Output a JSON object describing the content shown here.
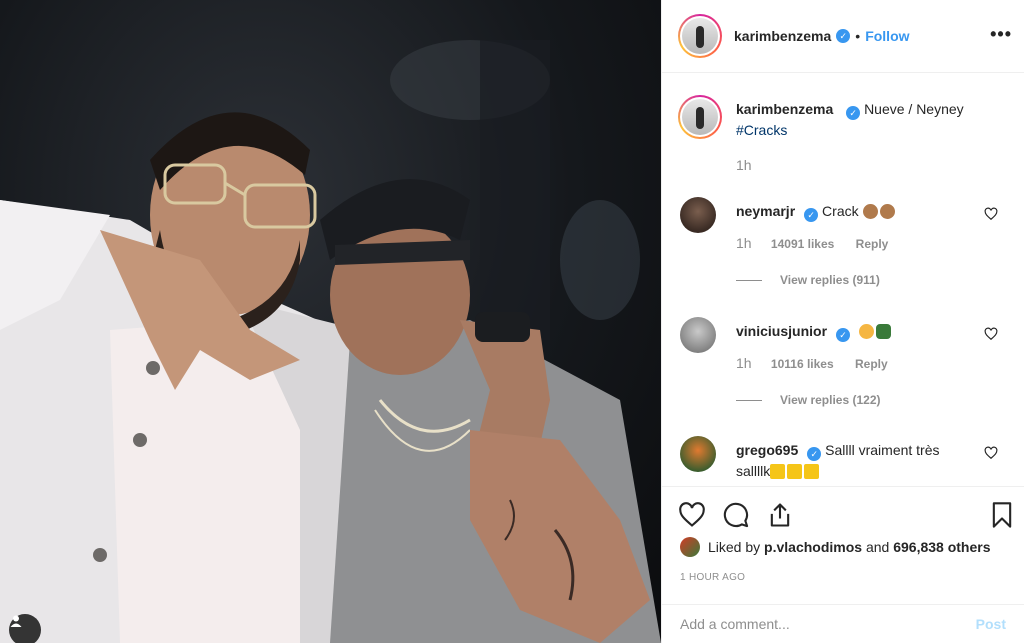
{
  "post": {
    "author": "karimbenzema",
    "follow_label": "Follow",
    "dot": "•",
    "more_label": "•••"
  },
  "caption": {
    "user": "karimbenzema",
    "text": "Nueve / Neyney",
    "hashtag": "#Cracks",
    "time": "1h"
  },
  "comments": [
    {
      "user": "neymarjr",
      "text": "Crack",
      "emojis": [
        "clapping-hands",
        "clapping-hands"
      ],
      "time": "1h",
      "likes": "14091 likes",
      "reply_label": "Reply",
      "view_replies": "View replies (911)"
    },
    {
      "user": "viniciusjunior",
      "text": "",
      "emojis": [
        "star-struck-face",
        "soccer-cleat"
      ],
      "time": "1h",
      "likes": "10116 likes",
      "reply_label": "Reply",
      "view_replies": "View replies (122)"
    },
    {
      "user": "grego695",
      "text": "Sallll vraiment très sallllk",
      "emojis": [
        "lightning",
        "lightning",
        "lightning"
      ]
    }
  ],
  "engagement": {
    "liked_by_prefix": "Liked by",
    "liked_by_user": "p.vlachodimos",
    "and_label": "and",
    "others": "696,838 others",
    "time_ago": "1 HOUR AGO"
  },
  "add_comment": {
    "placeholder": "Add a comment...",
    "post_label": "Post"
  },
  "colors": {
    "accent": "#3897f0",
    "hashtag": "#003569",
    "meta": "#8e8e8e",
    "border": "#efefef",
    "post_disabled": "#b2dffc"
  },
  "icons": [
    "user-tag-icon",
    "verified-badge-icon",
    "more-options-icon",
    "heart-icon",
    "comment-icon",
    "share-icon",
    "bookmark-icon"
  ]
}
